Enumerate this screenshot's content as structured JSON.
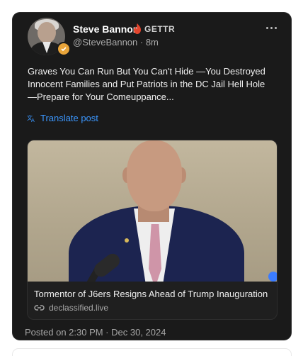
{
  "author": {
    "name": "Steve Bannon",
    "platform": "GETTR",
    "handle": "@SteveBannon · 8m",
    "avatar_icon": "profile-photo",
    "verified_icon": "verified-badge-icon"
  },
  "post": {
    "text": "Graves You Can Run But You Can't Hide —You Destroyed Innocent Families and Put Patriots in the DC Jail Hell Hole —Prepare for Your Comeuppance...",
    "translate_label": "Translate post",
    "posted": "Posted on 2:30 PM · Dec 30, 2024"
  },
  "link_preview": {
    "title": "Tormentor of J6ers Resigns Ahead of Trump Inauguration",
    "domain": "declassified.live"
  },
  "colors": {
    "card_bg": "#1a1a1a",
    "accent_blue": "#3b97ff",
    "flame_red": "#e3452d",
    "badge_gold": "#e8a43a"
  }
}
